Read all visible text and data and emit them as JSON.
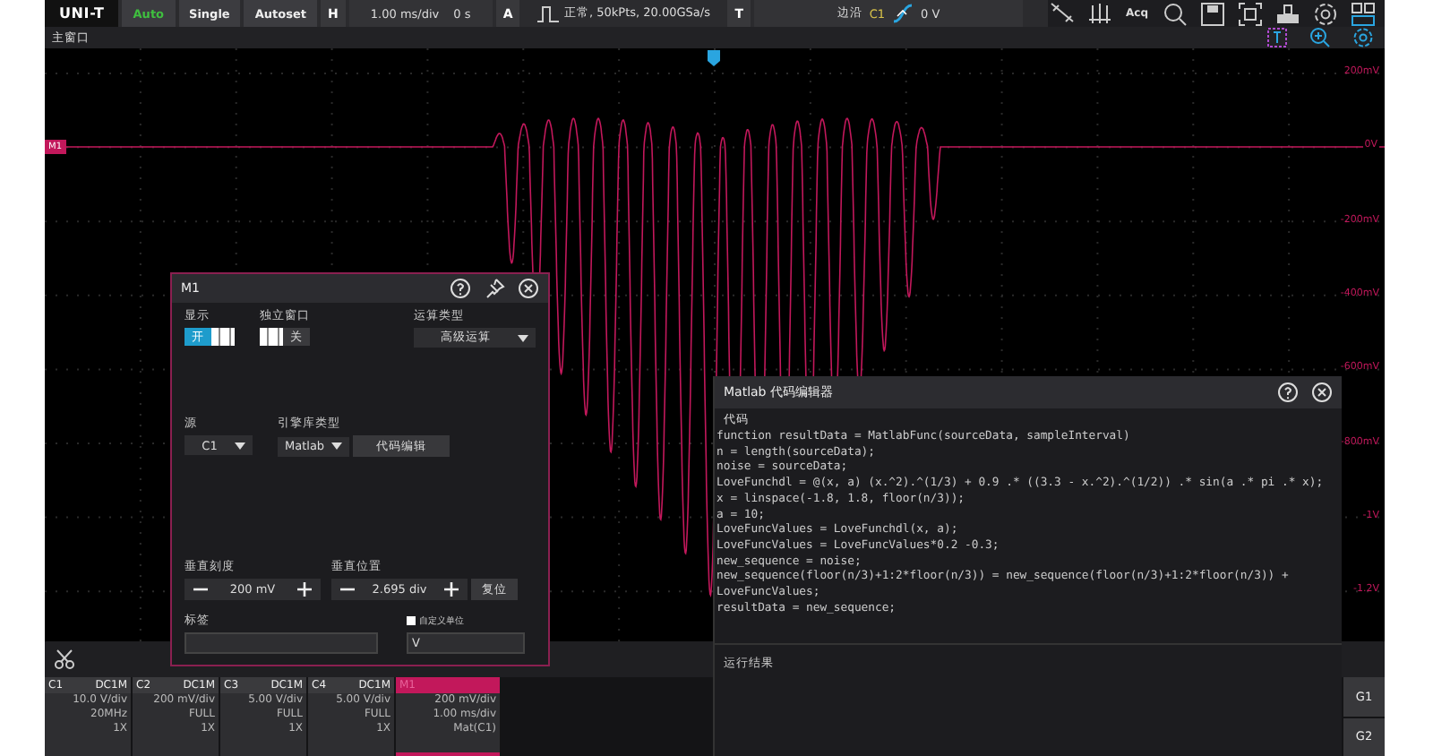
{
  "top_bar": {
    "logo": "UNI-T",
    "run_buttons": [
      {
        "label": "Auto",
        "selected": true
      },
      {
        "label": "Single",
        "selected": false
      },
      {
        "label": "Autoset",
        "selected": false
      }
    ],
    "horizontal": {
      "key": "H",
      "scale": "1.00 ms/div",
      "offset": "0 s"
    },
    "acquire": {
      "key": "A",
      "mode": "正常, 50kPts, 20.00GSa/s"
    },
    "trigger": {
      "key": "T",
      "type": "边沿",
      "source": "C1",
      "level": "0 V"
    },
    "acq_label": "Acq"
  },
  "window_bar": {
    "title": "主窗口"
  },
  "graph": {
    "trace_label": "M1",
    "scale_labels": [
      "200mV",
      "0V",
      "-200mV",
      "-400mV",
      "-600mV",
      "-800mV",
      "-1V",
      "-1.2V"
    ]
  },
  "math_dialog": {
    "title": "M1",
    "switches": [
      {
        "label": "显示",
        "on": true,
        "text": "开"
      },
      {
        "label": "独立窗口",
        "on": false,
        "text": "关"
      }
    ],
    "operation": {
      "label": "运算类型",
      "value": "高级运算"
    },
    "source": {
      "label": "源",
      "value": "C1"
    },
    "engine": {
      "label": "引擎库类型",
      "value": "Matlab",
      "button": "代码编辑"
    },
    "vertical_scale": {
      "label": "垂直刻度",
      "value": "200 mV"
    },
    "vertical_position": {
      "label": "垂直位置",
      "value": "2.695 div",
      "reset": "复位"
    },
    "tag": {
      "label": "标签"
    },
    "custom_unit": {
      "label": "自定义单位",
      "checked": false,
      "value": "V"
    }
  },
  "code_editor": {
    "title": "Matlab 代码编辑器",
    "section": "代码",
    "lines": [
      "function resultData = MatlabFunc(sourceData, sampleInterval)",
      "n = length(sourceData);",
      "noise = sourceData;",
      "LoveFunchdl = @(x, a) (x.^2).^(1/3) + 0.9 .* ((3.3 - x.^2).^(1/2)) .* sin(a .* pi .* x);",
      "x = linspace(-1.8, 1.8, floor(n/3));",
      "a = 10;",
      "LoveFuncValues = LoveFunchdl(x, a);",
      "LoveFuncValues = LoveFuncValues*0.2 -0.3;",
      "new_sequence = noise;",
      "new_sequence(floor(n/3)+1:2*floor(n/3)) = new_sequence(floor(n/3)+1:2*floor(n/3)) +",
      "LoveFuncValues;",
      "resultData = new_sequence;"
    ],
    "result_label": "运行结果"
  },
  "channels": [
    {
      "kind": "channel",
      "name": "C1",
      "coupling": "DC1M",
      "lines": [
        "10.0 V/div",
        "20MHz",
        "1X"
      ]
    },
    {
      "kind": "channel",
      "name": "C2",
      "coupling": "DC1M",
      "lines": [
        "200 mV/div",
        "FULL",
        "1X"
      ]
    },
    {
      "kind": "channel",
      "name": "C3",
      "coupling": "DC1M",
      "lines": [
        "5.00 V/div",
        "FULL",
        "1X"
      ]
    },
    {
      "kind": "channel",
      "name": "C4",
      "coupling": "DC1M",
      "lines": [
        "5.00 V/div",
        "FULL",
        "1X"
      ]
    },
    {
      "kind": "math",
      "name": "M1",
      "lines": [
        "200 mV/div",
        "1.00 ms/div",
        "Mat(C1)"
      ]
    }
  ],
  "side_buttons": [
    "G1",
    "G2"
  ]
}
